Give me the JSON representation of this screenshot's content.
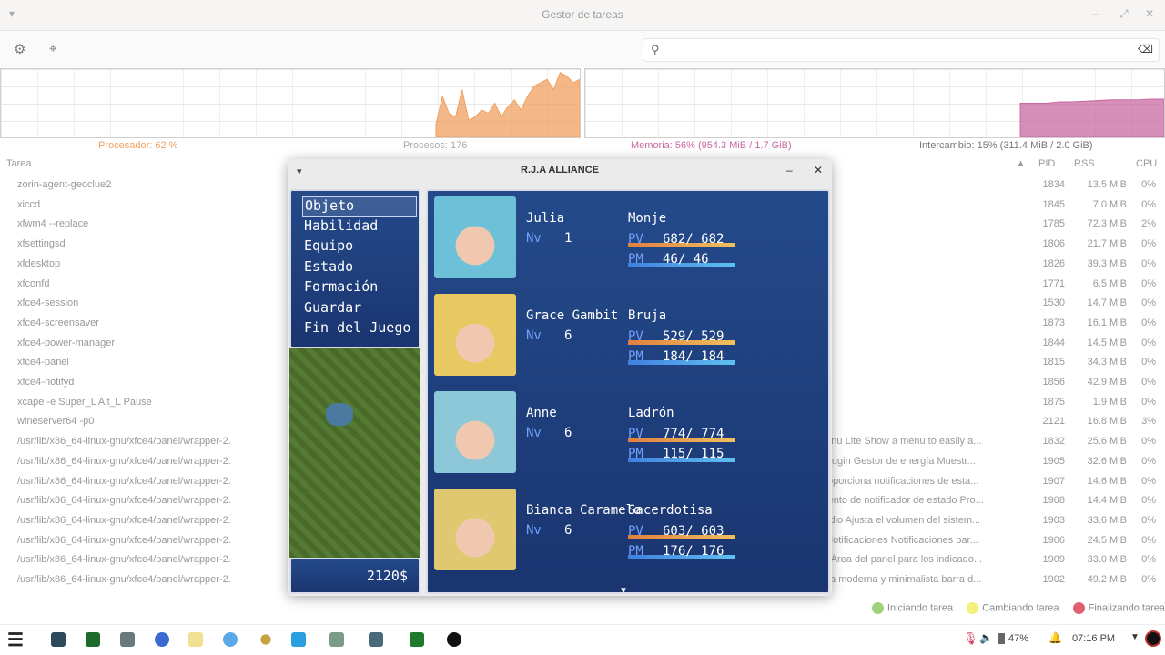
{
  "window": {
    "title": "Gestor de tareas"
  },
  "search": {
    "placeholder": ""
  },
  "stats": {
    "cpu": "Procesador: 62 %",
    "processes": "Procesos: 176",
    "memory": "Memoria: 56% (954.3 MiB / 1.7 GiB)",
    "swap": "Intercambio: 15% (311.4 MiB / 2.0 GiB)"
  },
  "cpu_history": [
    20,
    60,
    35,
    30,
    70,
    25,
    30,
    40,
    35,
    50,
    30,
    45,
    55,
    40,
    60,
    75,
    80,
    85,
    70,
    95,
    90,
    80,
    85
  ],
  "mem_history": [
    50,
    50,
    50,
    52,
    52,
    53,
    54,
    55,
    55,
    55,
    56,
    56
  ],
  "columns": {
    "task": "Tarea",
    "pid": "PID",
    "rss": "RSS",
    "cpu": "CPU"
  },
  "processes": [
    {
      "name": "zorin-agent-geoclue2",
      "desc": "",
      "pid": "1834",
      "rss": "13.5 MiB",
      "cpu": "0%"
    },
    {
      "name": "xiccd",
      "desc": "",
      "pid": "1845",
      "rss": "7.0 MiB",
      "cpu": "0%"
    },
    {
      "name": "xfwm4 --replace",
      "desc": "",
      "pid": "1785",
      "rss": "72.3 MiB",
      "cpu": "2%"
    },
    {
      "name": "xfsettingsd",
      "desc": "",
      "pid": "1806",
      "rss": "21.7 MiB",
      "cpu": "0%"
    },
    {
      "name": "xfdesktop",
      "desc": "",
      "pid": "1826",
      "rss": "39.3 MiB",
      "cpu": "0%"
    },
    {
      "name": "xfconfd",
      "desc": "",
      "pid": "1771",
      "rss": "6.5 MiB",
      "cpu": "0%"
    },
    {
      "name": "xfce4-session",
      "desc": "",
      "pid": "1530",
      "rss": "14.7 MiB",
      "cpu": "0%"
    },
    {
      "name": "xfce4-screensaver",
      "desc": "",
      "pid": "1873",
      "rss": "16.1 MiB",
      "cpu": "0%"
    },
    {
      "name": "xfce4-power-manager",
      "desc": "",
      "pid": "1844",
      "rss": "14.5 MiB",
      "cpu": "0%"
    },
    {
      "name": "xfce4-panel",
      "desc": "",
      "pid": "1815",
      "rss": "34.3 MiB",
      "cpu": "0%"
    },
    {
      "name": "xfce4-notifyd",
      "desc": "",
      "pid": "1856",
      "rss": "42.9 MiB",
      "cpu": "0%"
    },
    {
      "name": "xcape -e Super_L Alt_L Pause",
      "desc": "",
      "pid": "1875",
      "rss": "1.9 MiB",
      "cpu": "0%"
    },
    {
      "name": "wineserver64 -p0",
      "desc": "",
      "pid": "2121",
      "rss": "16.8 MiB",
      "cpu": "3%"
    },
    {
      "name": "/usr/lib/x86_64-linux-gnu/xfce4/panel/wrapper-2.",
      "desc": "Menu Lite Show a menu to easily a...",
      "pid": "1832",
      "rss": "25.6 MiB",
      "cpu": "0%"
    },
    {
      "name": "/usr/lib/x86_64-linux-gnu/xfce4/panel/wrapper-2.",
      "desc": "r-plugin Gestor de energía Muestr...",
      "pid": "1905",
      "rss": "32.6 MiB",
      "cpu": "0%"
    },
    {
      "name": "/usr/lib/x86_64-linux-gnu/xfce4/panel/wrapper-2.",
      "desc": "Proporciona notificaciones de esta...",
      "pid": "1907",
      "rss": "14.6 MiB",
      "cpu": "0%"
    },
    {
      "name": "/usr/lib/x86_64-linux-gnu/xfce4/panel/wrapper-2.",
      "desc": "miento de notificador de estado Pro...",
      "pid": "1908",
      "rss": "14.4 MiB",
      "cpu": "0%"
    },
    {
      "name": "/usr/lib/x86_64-linux-gnu/xfce4/panel/wrapper-2.",
      "desc": "Audio Ajusta el volumen del sistem...",
      "pid": "1903",
      "rss": "33.6 MiB",
      "cpu": "0%"
    },
    {
      "name": "/usr/lib/x86_64-linux-gnu/xfce4/panel/wrapper-2.",
      "desc": "n Notificaciones Notificaciones par...",
      "pid": "1906",
      "rss": "24.5 MiB",
      "cpu": "0%"
    },
    {
      "name": "/usr/lib/x86_64-linux-gnu/xfce4/panel/wrapper-2.",
      "desc": "es Área del panel para los indicado...",
      "pid": "1909",
      "rss": "33.0 MiB",
      "cpu": "0%"
    },
    {
      "name": "/usr/lib/x86_64-linux-gnu/xfce4/panel/wrapper-2.",
      "desc": "Una moderna y minimalista barra d...",
      "pid": "1902",
      "rss": "49.2 MiB",
      "cpu": "0%"
    }
  ],
  "legend": {
    "starting": "Iniciando tarea",
    "changing": "Cambiando tarea",
    "ending": "Finalizando tarea"
  },
  "colors": {
    "cpu": "#f0a060",
    "memory": "#c86aa0",
    "starting": "#9fd27a",
    "changing": "#f5f07a",
    "ending": "#e0606e"
  },
  "game": {
    "title": "R.J.A ALLIANCE",
    "menu": [
      "Objeto",
      "Habilidad",
      "Equipo",
      "Estado",
      "Formación",
      "Guardar",
      "Fin del Juego"
    ],
    "gold": "2120$",
    "lv_label": "Nv",
    "hp_label": "PV",
    "mp_label": "PM",
    "party": [
      {
        "name": "Julia",
        "class": "Monje",
        "level": "1",
        "hp": "682/ 682",
        "mp": "46/  46",
        "hp_frac": 1,
        "mp_frac": 1,
        "face_color": "#6cc0d8"
      },
      {
        "name": "Grace Gambit",
        "class": "Bruja",
        "level": "6",
        "hp": "529/ 529",
        "mp": "184/ 184",
        "hp_frac": 1,
        "mp_frac": 1,
        "face_color": "#e8c860"
      },
      {
        "name": "Anne",
        "class": "Ladrón",
        "level": "6",
        "hp": "774/ 774",
        "mp": "115/ 115",
        "hp_frac": 1,
        "mp_frac": 1,
        "face_color": "#8cc8d8"
      },
      {
        "name": "Bianca Caramelo",
        "class": "Sacerdotisa",
        "level": "6",
        "hp": "603/ 603",
        "mp": "176/ 176",
        "hp_frac": 1,
        "mp_frac": 1,
        "face_color": "#e0c870"
      }
    ]
  },
  "tray": {
    "battery": "47%",
    "clock": "07:16 PM"
  }
}
